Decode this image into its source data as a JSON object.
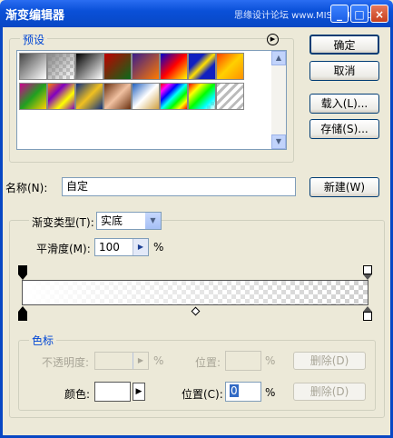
{
  "window": {
    "title": "渐变编辑器",
    "watermark": "思缘设计论坛 www.MISSYUAN.COM",
    "minimize_glyph": "_",
    "maximize_glyph": "□",
    "close_glyph": "×"
  },
  "presets": {
    "group_label": "预设",
    "menu_glyph": "▶",
    "scroll_up_glyph": "▲",
    "scroll_down_glyph": "▼"
  },
  "buttons": {
    "ok": "确定",
    "cancel": "取消",
    "load": "载入(L)...",
    "save": "存储(S)...",
    "new": "新建(W)"
  },
  "name": {
    "label": "名称(N):",
    "value": "自定"
  },
  "gradient": {
    "type_label": "渐变类型(T):",
    "type_value": "实底",
    "smoothness_label": "平滑度(M):",
    "smoothness_value": "100",
    "smoothness_unit": "%",
    "dropdown_glyph": "▼",
    "arrow_glyph": "▶"
  },
  "stops": {
    "group_label": "色标",
    "opacity_label": "不透明度:",
    "opacity_unit": "%",
    "opacity_position_label": "位置:",
    "opacity_position_unit": "%",
    "opacity_delete": "删除(D)",
    "color_label": "颜色:",
    "color_arrow": "▶",
    "color_position_label": "位置(C):",
    "color_position_value": "0",
    "color_position_unit": "%",
    "color_delete": "删除(D)"
  },
  "colors": {
    "title_bar": "#0a50d8",
    "group_label": "#0046d5",
    "dialog_bg": "#ece9d8"
  }
}
